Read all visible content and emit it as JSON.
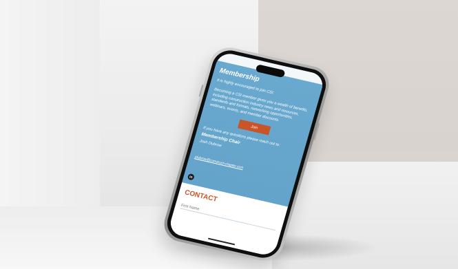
{
  "membership": {
    "heading": "Membership",
    "intro": "It is highly encouraged to join CSI.",
    "body": "Becoming a CSI member gives you a wealth of benefits, including construction industry news and resources, standards and formats, networking opportunities, webinars, events, and member discounts.",
    "join_label": "Join",
    "questions": "If you have any questions please reach out to:",
    "chair_title": "Membership Chair",
    "chair_name": "Josh Dubrow",
    "chair_email": "jdubrow@construct-chapter.com",
    "social_icon": "linkedin-icon",
    "social_glyph": "in"
  },
  "contact": {
    "heading": "CONTACT",
    "first_name_placeholder": "First Name"
  },
  "colors": {
    "panel_blue": "#6aa9cf",
    "accent_orange": "#c95428"
  }
}
